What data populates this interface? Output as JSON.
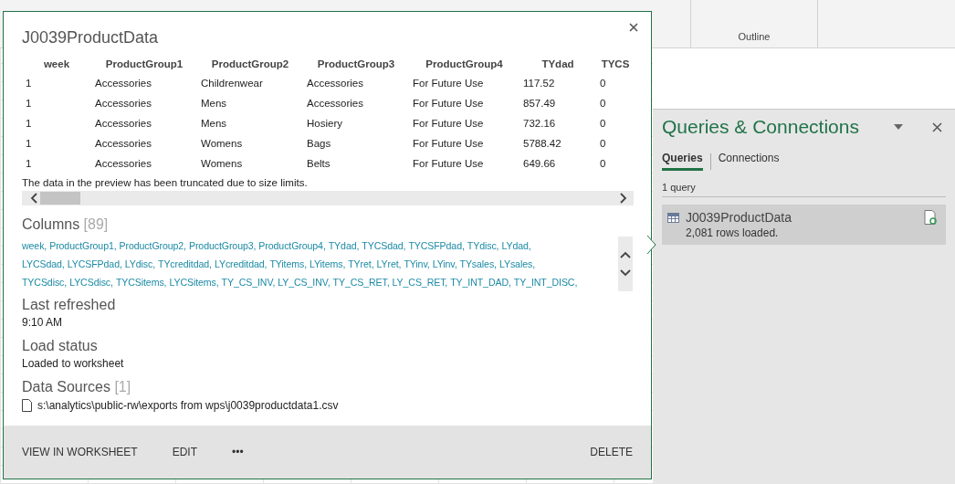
{
  "ribbon": {
    "group_label": "Outline"
  },
  "popup": {
    "title": "J0039ProductData",
    "table": {
      "columns": [
        "week",
        "ProductGroup1",
        "ProductGroup2",
        "ProductGroup3",
        "ProductGroup4",
        "TYdad",
        "TYCS"
      ],
      "rows": [
        [
          "1",
          "Accessories",
          "Childrenwear",
          "Accessories",
          "For Future Use",
          "117.52",
          "0"
        ],
        [
          "1",
          "Accessories",
          "Mens",
          "Accessories",
          "For Future Use",
          "857.49",
          "0"
        ],
        [
          "1",
          "Accessories",
          "Mens",
          "Hosiery",
          "For Future Use",
          "732.16",
          "0"
        ],
        [
          "1",
          "Accessories",
          "Womens",
          "Bags",
          "For Future Use",
          "5788.42",
          "0"
        ],
        [
          "1",
          "Accessories",
          "Womens",
          "Belts",
          "For Future Use",
          "649.66",
          "0"
        ]
      ]
    },
    "truncation_note": "The data in the preview has been truncated due to size limits.",
    "columns_heading": "Columns",
    "columns_count": "[89]",
    "column_lines": [
      [
        "week,",
        "ProductGroup1,",
        "ProductGroup2,",
        "ProductGroup3,",
        "ProductGroup4,",
        "TYdad,",
        "TYCSdad,",
        "TYCSFPdad,",
        "TYdisc,",
        "LYdad,"
      ],
      [
        "LYCSdad,",
        "LYCSFPdad,",
        "LYdisc,",
        "TYcreditdad,",
        "LYcreditdad,",
        "TYitems,",
        "LYitems,",
        "TYret,",
        "LYret,",
        "TYinv,",
        "LYinv,",
        "TYsales,",
        "LYsales,"
      ],
      [
        "TYCSdisc,",
        "LYCSdisc,",
        "TYCSitems,",
        "LYCSitems,",
        "TY_CS_INV,",
        "LY_CS_INV,",
        "TY_CS_RET,",
        "LY_CS_RET,",
        "TY_INT_DAD,",
        "TY_INT_DISC,"
      ]
    ],
    "last_refreshed_heading": "Last refreshed",
    "last_refreshed": "9:10 AM",
    "load_status_heading": "Load status",
    "load_status": "Loaded to worksheet",
    "sources_heading": "Data Sources",
    "sources_count": "[1]",
    "source_path": "s:\\analytics\\public-rw\\exports from wps\\j0039productdata1.csv",
    "actions": [
      "VIEW IN WORKSHEET",
      "EDIT",
      "•••"
    ],
    "delete_action": "DELETE"
  },
  "pane": {
    "title": "Queries & Connections",
    "tabs": [
      {
        "label": "Queries",
        "selected": true
      },
      {
        "label": "Connections",
        "selected": false
      }
    ],
    "count": "1 query",
    "queries": [
      {
        "name": "J0039ProductData",
        "status": "2,081 rows loaded.",
        "selected": true
      }
    ]
  }
}
